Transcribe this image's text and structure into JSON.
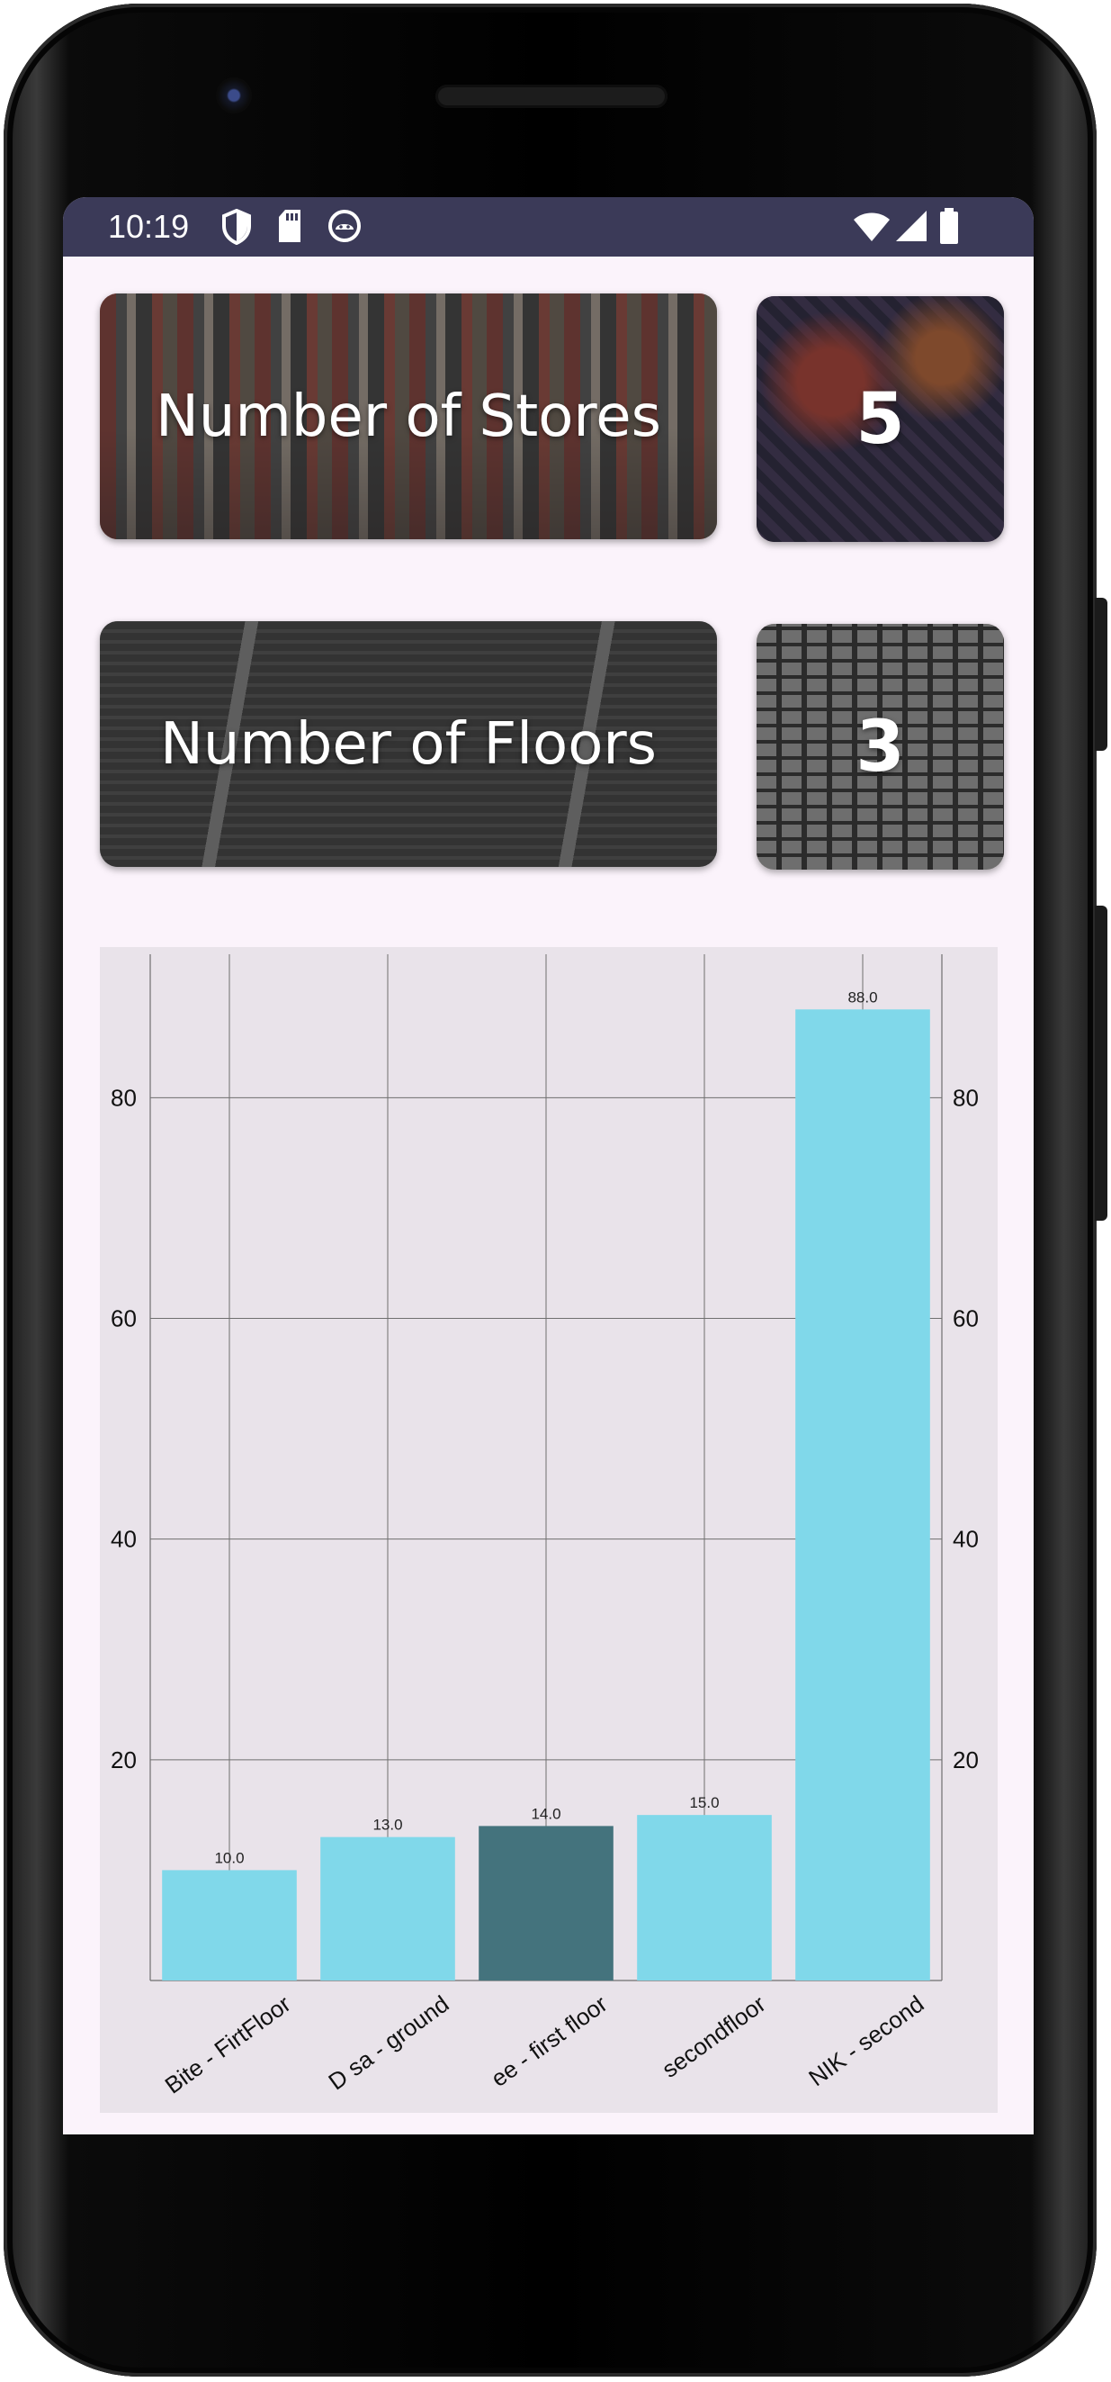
{
  "status_bar": {
    "time": "10:19",
    "left_icons": [
      "shield-icon",
      "sd-card-icon",
      "android-icon"
    ],
    "right_icons": [
      "wifi-icon",
      "signal-icon",
      "battery-icon"
    ]
  },
  "cards": {
    "stores": {
      "label": "Number of Stores",
      "value": "5"
    },
    "floors": {
      "label": "Number of Floors",
      "value": "3"
    }
  },
  "chart_data": {
    "type": "bar",
    "categories": [
      "Bite - FirtFloor",
      "D sa - ground",
      "ee - first floor",
      "secondfloor",
      "NIK - second"
    ],
    "values": [
      10.0,
      13.0,
      14.0,
      15.0,
      88.0
    ],
    "value_labels": [
      "10.0",
      "13.0",
      "14.0",
      "15.0",
      "88.0"
    ],
    "highlighted_index": 2,
    "ylim": [
      0,
      93
    ],
    "yticks": [
      20,
      40,
      60,
      80
    ],
    "grid": true,
    "colors": {
      "bar": "#80d8ea",
      "highlight": "#44737d",
      "background": "#e9e3ea",
      "grid": "#6f6f6f"
    }
  }
}
